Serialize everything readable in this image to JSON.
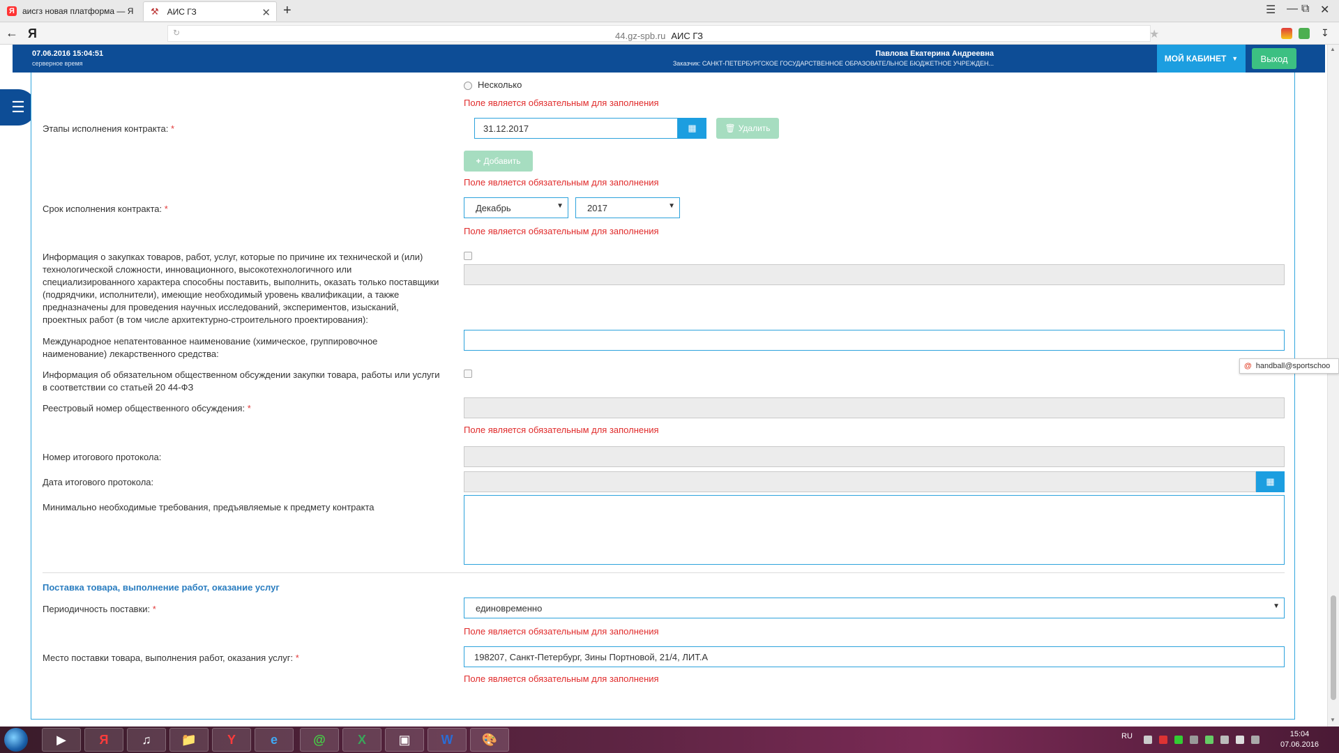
{
  "browser": {
    "tabs": [
      {
        "label": "аисгз новая платформа — Я",
        "active": false
      },
      {
        "label": "АИС ГЗ",
        "active": true
      }
    ],
    "address": {
      "host": "44.gz-spb.ru",
      "title": "АИС ГЗ"
    }
  },
  "header": {
    "server_time": "07.06.2016 15:04:51",
    "server_time_label": "серверное время",
    "user_name": "Павлова Екатерина Андреевна",
    "user_org": "Заказчик: САНКТ-ПЕТЕРБУРГСКОЕ ГОСУДАРСТВЕННОЕ ОБРАЗОВАТЕЛЬНОЕ БЮДЖЕТНОЕ УЧРЕЖДЕН...",
    "cabinet_label": "МОЙ КАБИНЕТ",
    "exit_label": "Выход"
  },
  "form": {
    "radio_several": "Несколько",
    "required_error": "Поле является обязательным для заполнения",
    "stages_label": "Этапы исполнения контракта:",
    "stage_date": "31.12.2017",
    "delete_label": "Удалить",
    "add_label": "Добавить",
    "term_label": "Срок исполнения контракта:",
    "term_month": "Декабрь",
    "term_year": "2017",
    "complex_info_label": "Информация о закупках товаров, работ, услуг, которые по причине их технической и (или) технологической сложности, инновационного, высокотехнологичного или специализированного характера способны поставить, выполнить, оказать только поставщики (подрядчики, исполнители), имеющие необходимый уровень квалификации, а также предназначены для проведения научных исследований, экспериментов, изысканий, проектных работ (в том числе архитектурно-строительного проектирования):",
    "inn_label": "Международное непатентованное наименование (химическое, группировочное наименование) лекарственного средства:",
    "discussion_label": "Информация об обязательном общественном обсуждении закупки товара, работы или услуги в соответствии со статьей 20 44-ФЗ",
    "registry_label": "Реестровый номер общественного обсуждения:",
    "protocol_no_label": "Номер итогового протокола:",
    "protocol_date_label": "Дата итогового протокола:",
    "min_req_label": "Минимально необходимые требования, предъявляемые к предмету контракта",
    "section_title": "Поставка товара, выполнение работ, оказание услуг",
    "periodicity_label": "Периодичность поставки:",
    "periodicity_value": "единовременно",
    "place_label": "Место поставки товара, выполнения работ, оказания услуг:",
    "place_value": "198207, Санкт-Петербург, Зины Портновой, 21/4, ЛИТ.А"
  },
  "tooltip": {
    "text": "handball@sportschoo"
  },
  "taskbar": {
    "lang": "RU",
    "time": "15:04",
    "date": "07.06.2016"
  }
}
